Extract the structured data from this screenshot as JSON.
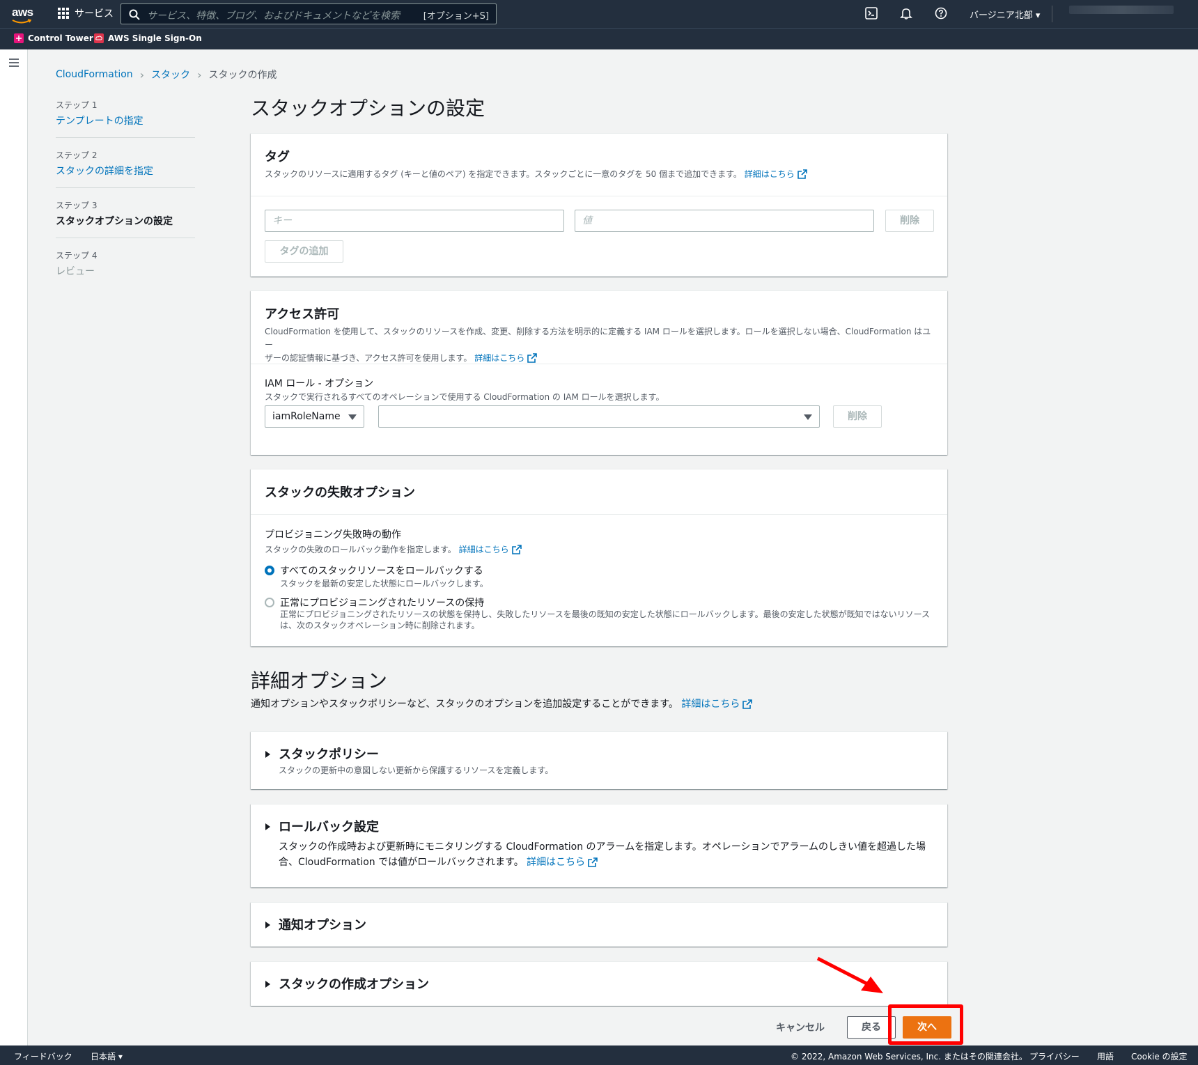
{
  "topnav": {
    "logo": "aws",
    "services_label": "サービス",
    "search_placeholder": "サービス、特徴、ブログ、およびドキュメントなどを検索",
    "search_shortcut": "[オプション+S]",
    "region": "バージニア北部 ▾",
    "icons": [
      "cloudshell-icon",
      "bell-icon",
      "help-icon"
    ]
  },
  "favorites": [
    {
      "label": "Control Tower",
      "color": "#e7157b"
    },
    {
      "label": "AWS Single Sign-On",
      "color": "#dd344c"
    }
  ],
  "breadcrumb": [
    "CloudFormation",
    "スタック",
    "スタックの作成"
  ],
  "steps": [
    {
      "num": "ステップ 1",
      "label": "テンプレートの指定",
      "state": "link"
    },
    {
      "num": "ステップ 2",
      "label": "スタックの詳細を指定",
      "state": "link"
    },
    {
      "num": "ステップ 3",
      "label": "スタックオプションの設定",
      "state": "active"
    },
    {
      "num": "ステップ 4",
      "label": "レビュー",
      "state": "disabled"
    }
  ],
  "page_title": "スタックオプションの設定",
  "tags": {
    "title": "タグ",
    "desc": "スタックのリソースに適用するタグ (キーと値のペア) を指定できます。スタックごとに一意のタグを 50 個まで追加できます。",
    "learn_more": "詳細はこちら",
    "key_placeholder": "キー",
    "value_placeholder": "値",
    "remove": "削除",
    "add": "タグの追加"
  },
  "permissions": {
    "title": "アクセス許可",
    "desc1": "CloudFormation を使用して、スタックのリソースを作成、変更、削除する方法を明示的に定義する IAM ロールを選択します。ロールを選択しない場合、CloudFormation はユー",
    "desc2": "ザーの認証情報に基づき、アクセス許可を使用します。",
    "learn_more": "詳細はこちら",
    "role_label": "IAM ロール - オプション",
    "role_desc": "スタックで実行されるすべてのオペレーションで使用する CloudFormation の IAM ロールを選択します。",
    "role_type": "iamRoleName",
    "role_value": "",
    "remove": "削除"
  },
  "failure": {
    "title": "スタックの失敗オプション",
    "label": "プロビジョニング失敗時の動作",
    "desc": "スタックの失敗のロールバック動作を指定します。",
    "learn_more": "詳細はこちら",
    "opt1_label": "すべてのスタックリソースをロールバックする",
    "opt1_desc": "スタックを最新の安定した状態にロールバックします。",
    "opt2_label": "正常にプロビジョニングされたリソースの保持",
    "opt2_desc1": "正常にプロビジョニングされたリソースの状態を保持し、失敗したリソースを最後の既知の安定した状態にロールバックします。最後の安定した状態が既知ではないリソース",
    "opt2_desc2": "は、次のスタックオペレーション時に削除されます。",
    "selected": "opt1"
  },
  "advanced": {
    "title": "詳細オプション",
    "desc": "通知オプションやスタックポリシーなど、スタックのオプションを追加設定することができます。",
    "learn_more": "詳細はこちら",
    "policy_title": "スタックポリシー",
    "policy_desc": "スタックの更新中の意図しない更新から保護するリソースを定義します。",
    "rollback_title": "ロールバック設定",
    "rollback_desc1": "スタックの作成時および更新時にモニタリングする CloudFormation のアラームを指定します。オペレーションでアラームのしきい値を超過した場",
    "rollback_desc2": "合、CloudFormation では値がロールバックされます。",
    "rollback_learn_more": "詳細はこちら",
    "notify_title": "通知オプション",
    "create_title": "スタックの作成オプション"
  },
  "actions": {
    "cancel": "キャンセル",
    "back": "戻る",
    "next": "次へ"
  },
  "footer": {
    "feedback": "フィードバック",
    "language": "日本語 ▾",
    "copyright": "© 2022, Amazon Web Services, Inc. またはその関連会社。",
    "privacy": "プライバシー",
    "terms": "用語",
    "cookies": "Cookie の設定"
  },
  "colors": {
    "primary": "#ec7211",
    "link": "#0073bb",
    "nav": "#232f3e",
    "highlight": "#ff0000"
  }
}
